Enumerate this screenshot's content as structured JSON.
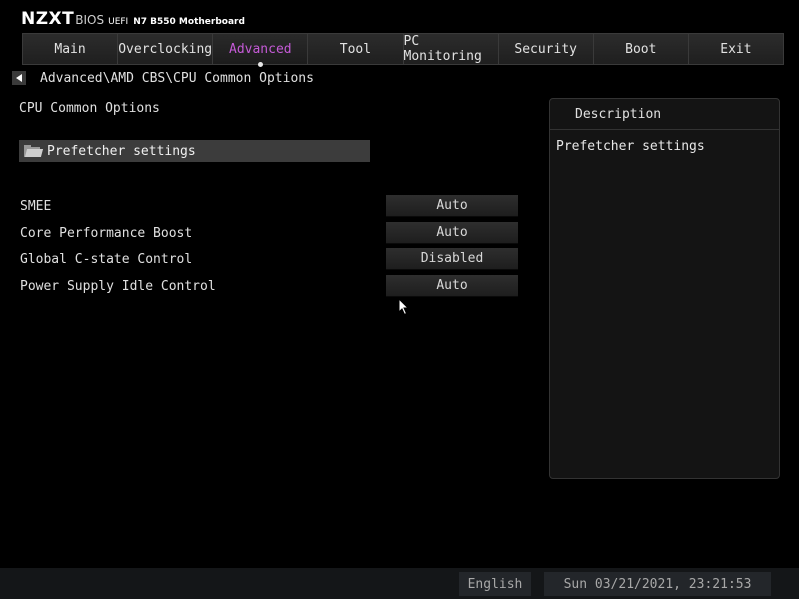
{
  "header": {
    "brand": "NZXT",
    "bios": "BIOS",
    "uefi": "UEFI",
    "model": "N7 B550 Motherboard"
  },
  "tabs": [
    {
      "label": "Main"
    },
    {
      "label": "Overclocking"
    },
    {
      "label": "Advanced"
    },
    {
      "label": "Tool"
    },
    {
      "label": "PC Monitoring"
    },
    {
      "label": "Security"
    },
    {
      "label": "Boot"
    },
    {
      "label": "Exit"
    }
  ],
  "active_tab": "Advanced",
  "breadcrumb": "Advanced\\AMD CBS\\CPU Common Options",
  "section_title": "CPU Common Options",
  "submenu": {
    "label": "Prefetcher settings",
    "icon": "folder-icon"
  },
  "settings": [
    {
      "label": "SMEE",
      "value": "Auto"
    },
    {
      "label": "Core Performance Boost",
      "value": "Auto"
    },
    {
      "label": "Global C-state Control",
      "value": "Disabled"
    },
    {
      "label": "Power Supply Idle Control",
      "value": "Auto"
    }
  ],
  "description": {
    "title": "Description",
    "text": "Prefetcher settings"
  },
  "footer": {
    "language": "English",
    "datetime": "Sun 03/21/2021, 23:21:53"
  },
  "colors": {
    "active_tab": "#c45ad6",
    "background": "#000000",
    "panel": "#141414"
  }
}
